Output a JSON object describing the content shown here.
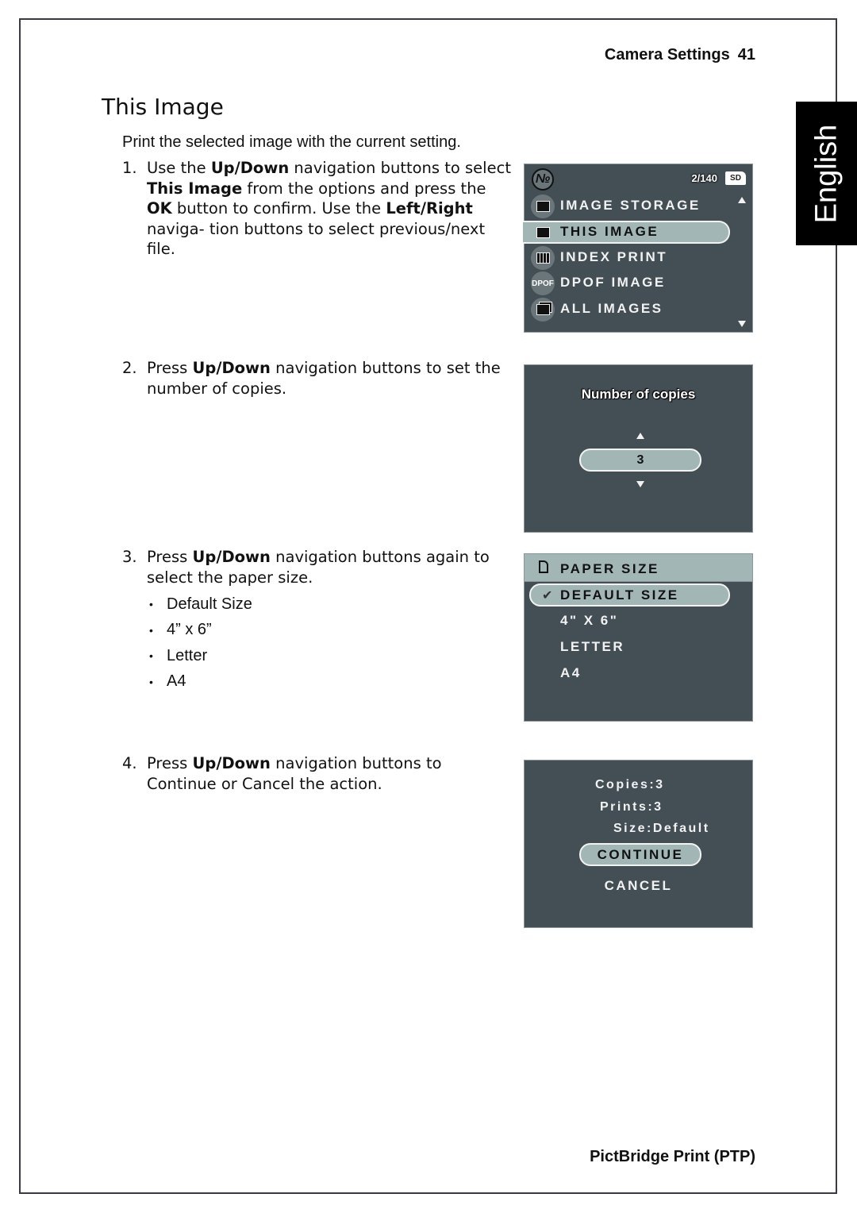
{
  "header": {
    "section": "Camera Settings",
    "page_number": "41"
  },
  "language_tab": "English",
  "title": "This Image",
  "intro": "Print the selected image with the current setting.",
  "steps": [
    {
      "num": "1.",
      "parts": [
        {
          "t": "Use the "
        },
        {
          "t": "Up/Down",
          "b": true
        },
        {
          "t": " navigation buttons to select "
        },
        {
          "t": "This Image",
          "b": true
        },
        {
          "t": " from the options and press the "
        },
        {
          "t": "OK",
          "b": true
        },
        {
          "t": " button to confirm. Use the "
        },
        {
          "t": "Left/Right",
          "b": true
        },
        {
          "t": " naviga- tion buttons to select previous/next file."
        }
      ]
    },
    {
      "num": "2.",
      "parts": [
        {
          "t": "Press "
        },
        {
          "t": "Up/Down",
          "b": true
        },
        {
          "t": " navigation buttons to set the number of copies."
        }
      ]
    },
    {
      "num": "3.",
      "parts": [
        {
          "t": "Press "
        },
        {
          "t": "Up/Down",
          "b": true
        },
        {
          "t": " navigation buttons again to select the paper size."
        }
      ]
    },
    {
      "num": "4.",
      "parts": [
        {
          "t": "Press "
        },
        {
          "t": "Up/Down",
          "b": true
        },
        {
          "t": " navigation buttons to Continue or Cancel the action."
        }
      ]
    }
  ],
  "paper_sizes": [
    "Default Size",
    "4” x 6”",
    "Letter",
    "A4"
  ],
  "screen1": {
    "counter": "2/140",
    "card": "SD",
    "items": [
      {
        "label": "IMAGE STORAGE",
        "icon": "camera-storage-icon"
      },
      {
        "label": "THIS IMAGE",
        "icon": "image-icon",
        "selected": true
      },
      {
        "label": "INDEX PRINT",
        "icon": "index-grid-icon"
      },
      {
        "label": "DPOF IMAGE",
        "icon": "dpof-icon",
        "icon_text": "DPOF"
      },
      {
        "label": "ALL IMAGES",
        "icon": "all-images-icon"
      }
    ]
  },
  "screen2": {
    "title": "Number of copies",
    "value": "3"
  },
  "screen3": {
    "header": "PAPER SIZE",
    "check": "✔",
    "options": [
      {
        "label": "DEFAULT SIZE",
        "selected": true
      },
      {
        "label": "4\" X 6\""
      },
      {
        "label": "LETTER"
      },
      {
        "label": "A4"
      }
    ]
  },
  "screen4": {
    "copies": "Copies:3",
    "prints": "Prints:3",
    "size": "Size:Default",
    "continue": "CONTINUE",
    "cancel": "CANCEL"
  },
  "footer": "PictBridge Print (PTP)",
  "colors": {
    "lcd_bg": "#434e55",
    "lcd_highlight": "#a3b6b6",
    "tab_bg": "#000000"
  }
}
